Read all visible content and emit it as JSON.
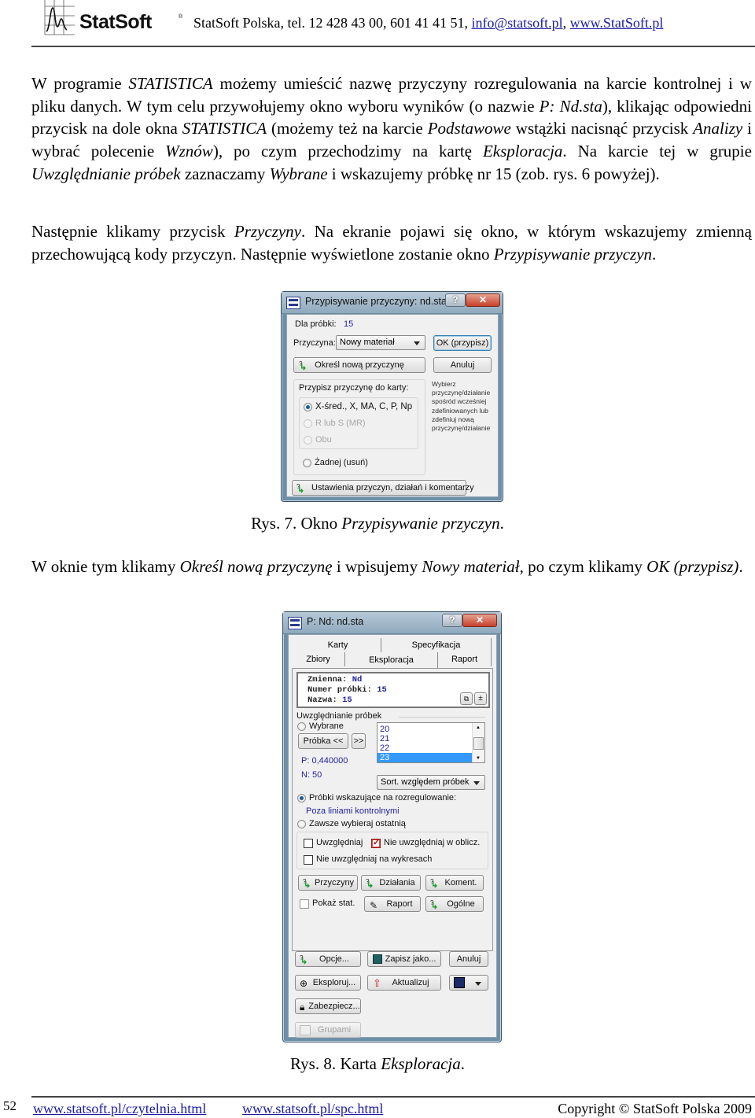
{
  "header": {
    "logo_text": "StatSoft",
    "logo_registered": "®",
    "contact_prefix": "StatSoft Polska, tel. 12 428 43 00, 601 41 41 51, ",
    "email": "info@statsoft.pl",
    "separator": ", ",
    "website": "www.StatSoft.pl"
  },
  "paragraph1": {
    "s1": "W programie ",
    "i1": "STATISTICA",
    "s2": " możemy umieścić nazwę przyczyny rozregulowania na karcie kontrolnej i w pliku danych. W tym celu przywołujemy okno wyboru wyników (o nazwie ",
    "i2": "P: Nd.sta",
    "s3": "), klikając odpowiedni przycisk na dole okna ",
    "i3": "STATISTICA",
    "s4": " (możemy też na karcie ",
    "i4": "Podstawowe",
    "s5": " wstążki nacisnąć przycisk ",
    "i5": "Analizy",
    "s6": " i wybrać polecenie ",
    "i6": "Wznów",
    "s7": "), po czym przechodzimy na kartę ",
    "i7": "Eksploracja",
    "s8": ". Na karcie tej w grupie ",
    "i8": "Uwzględnianie próbek",
    "s9": " zaznaczamy ",
    "i9": "Wybrane",
    "s10": " i wskazujemy próbkę nr 15 (zob. rys. 6 powyżej)."
  },
  "paragraph2": {
    "s1": "Następnie klikamy przycisk ",
    "i1": "Przyczyny",
    "s2": ". Na ekranie pojawi się okno, w którym wskazujemy zmienną przechowującą kody przyczyn. Następnie wyświetlone zostanie okno ",
    "i2": "Przypisywanie przyczyn",
    "s3": "."
  },
  "caption7": {
    "prefix": "Rys. 7. Okno ",
    "italic": "Przypisywanie przyczyn",
    "suffix": "."
  },
  "paragraph3": {
    "s1": "W oknie tym klikamy ",
    "i1": "Określ nową przyczynę",
    "s2": " i wpisujemy ",
    "i2": "Nowy materiał",
    "s3": ", po czym klikamy ",
    "i3": "OK (przypisz)",
    "s4": "."
  },
  "caption8": {
    "prefix": "Rys. 8. Karta ",
    "italic": "Eksploracja",
    "suffix": "."
  },
  "dialog1": {
    "title": "Przypisywanie przyczyny: nd.sta",
    "help": "?",
    "close": "✕",
    "sample_label": "Dla próbki:",
    "sample_value": "15",
    "cause_label": "Przyczyna:",
    "cause_value": "Nowy materiał",
    "ok_button": "OK (przypisz)",
    "define_button": "Określ nową przyczynę",
    "cancel_button": "Anuluj",
    "group_title": "Przypisz przyczynę do karty:",
    "radios": [
      {
        "label": "X-śred., X, MA, C, P, Np",
        "checked": true,
        "enabled": true
      },
      {
        "label": "R lub S (MR)",
        "checked": false,
        "enabled": false
      },
      {
        "label": "Obu",
        "checked": false,
        "enabled": false
      },
      {
        "label": "Żadnej (usuń)",
        "checked": false,
        "enabled": true
      }
    ],
    "hint": [
      "Wybierz",
      "przyczynę/działanie",
      "spośród wcześniej",
      "zdefiniowanych lub",
      "zdefiniuj nową",
      "przyczynę/działanie"
    ],
    "settings_button": "Ustawienia przyczyn, działań i komentarzy"
  },
  "dialog2": {
    "title": "P: Nd: nd.sta",
    "help": "?",
    "close": "✕",
    "tabs_row1": [
      "Karty",
      "Specyfikacja"
    ],
    "tabs_row2": [
      "Zbiory",
      "Eksploracja",
      "Raport"
    ],
    "active_tab": "Eksploracja",
    "info": {
      "variable_label": "Zmienna:",
      "variable_value": "Nd",
      "sample_label": "Numer próbki:",
      "sample_value": "15",
      "name_label": "Nazwa:",
      "name_value": "15"
    },
    "group_title": "Uwzględnianie próbek",
    "selected_radio": "Wybrane",
    "sample_btn": "Próbka <<",
    "next_btn": ">>",
    "p_value": "P: 0,440000",
    "n_value": "N: 50",
    "list_items": [
      "20",
      "21",
      "22",
      "23"
    ],
    "list_selected": "23",
    "sort_combo": "Sort. względem próbek",
    "radio_out_of_control": "Próbki wskazujące na rozregulowanie:",
    "out_of_control_value": "Poza liniami kontrolnymi",
    "radio_always_last": "Zawsze wybieraj ostatnią",
    "chk_include": {
      "label": "Uwzględniaj",
      "checked": false
    },
    "chk_exclude_calc": {
      "label": "Nie uwzględniaj w oblicz.",
      "checked": true
    },
    "chk_exclude_plots": {
      "label": "Nie uwzględniaj na wykresach",
      "checked": false
    },
    "btn_causes": "Przyczyny",
    "btn_actions": "Działania",
    "btn_comments": "Koment.",
    "chk_show_stats": {
      "label": "Pokaż stat.",
      "checked": false
    },
    "btn_report": "Raport",
    "btn_general": "Ogólne",
    "btn_options": "Opcje...",
    "btn_save_as": "Zapisz jako...",
    "btn_cancel": "Anuluj",
    "btn_explore": "Eksploruj...",
    "btn_update": "Aktualizuj",
    "btn_protect": "Zabezpiecz...",
    "btn_groups": "Grupami"
  },
  "footer": {
    "page_number": "52",
    "link1": "www.statsoft.pl/czytelnia.html",
    "link2": "www.statsoft.pl/spc.html",
    "copyright": "Copyright © StatSoft Polska 2009"
  }
}
